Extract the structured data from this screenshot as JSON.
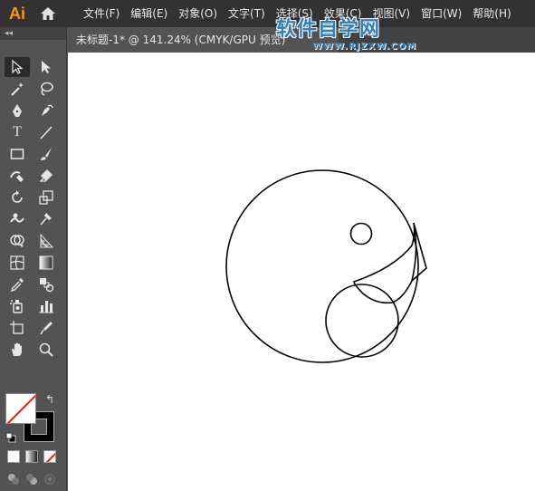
{
  "app": {
    "logo": "Ai",
    "menu": [
      "文件(F)",
      "编辑(E)",
      "对象(O)",
      "文字(T)",
      "选择(S)",
      "效果(C)",
      "视图(V)",
      "窗口(W)",
      "帮助(H)"
    ]
  },
  "document_tab": {
    "label": "未标题-1* @ 141.24% (CMYK/GPU 预览)"
  },
  "watermark": {
    "title": "软件自学网",
    "url": "WWW.RJZXW.COM"
  },
  "toolbar": {
    "collapse_label": "◂◂",
    "tools": [
      "selection-tool",
      "direct-selection-tool",
      "magic-wand-tool",
      "lasso-tool",
      "pen-tool",
      "curvature-tool",
      "type-tool",
      "line-segment-tool",
      "rectangle-tool",
      "paintbrush-tool",
      "shaper-tool",
      "eraser-tool",
      "rotate-tool",
      "scale-tool",
      "warp-tool",
      "puppet-warp-tool",
      "shape-builder-tool",
      "perspective-grid-tool",
      "mesh-tool",
      "gradient-tool",
      "eyedropper-tool",
      "blend-tool",
      "symbol-sprayer-tool",
      "column-graph-tool",
      "artboard-tool",
      "slice-tool",
      "hand-tool",
      "zoom-tool"
    ],
    "type_tool_glyph": "T"
  },
  "colors": {
    "fill": "#ffffff",
    "stroke": "#000000",
    "ui_dark": "#323232",
    "ui_panel": "#535353",
    "watermark": "#2d7fc4"
  }
}
